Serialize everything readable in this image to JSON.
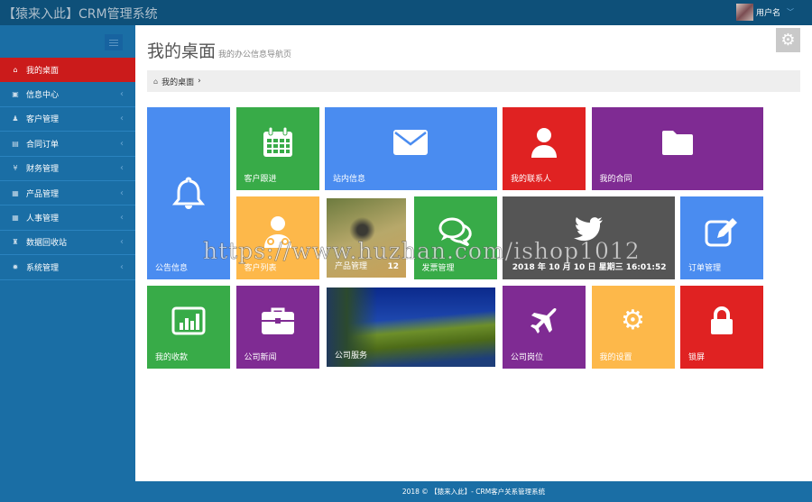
{
  "header": {
    "brand": "【猿来入此】CRM管理系统",
    "user_name": "用户名",
    "caret": "﹀"
  },
  "page": {
    "title": "我的桌面",
    "subtitle": "我的办公信息导航页"
  },
  "breadcrumb": {
    "items": [
      "我的桌面"
    ],
    "sep": "›"
  },
  "sidebar": {
    "items": [
      {
        "label": "我的桌面",
        "icon": "⌂",
        "active": true
      },
      {
        "label": "信息中心",
        "icon": "▣"
      },
      {
        "label": "客户管理",
        "icon": "♟"
      },
      {
        "label": "合同订单",
        "icon": "▤"
      },
      {
        "label": "财务管理",
        "icon": "¥"
      },
      {
        "label": "产品管理",
        "icon": "▦"
      },
      {
        "label": "人事管理",
        "icon": "▦"
      },
      {
        "label": "数据回收站",
        "icon": "♜"
      },
      {
        "label": "系统管理",
        "icon": "✹"
      }
    ],
    "chev": "‹"
  },
  "tiles": {
    "notice": "公告信息",
    "follow": "客户跟进",
    "messages": "站内信息",
    "contacts": "我的联系人",
    "contracts": "我的合同",
    "customers": "客户列表",
    "products": "产品管理",
    "products_count": "12",
    "invoices": "发票管理",
    "datetime": "2018 年 10 月 10 日 星期三 16:01:52",
    "orders": "订单管理",
    "receipts": "我的收款",
    "news": "公司新闻",
    "services": "公司服务",
    "positions": "公司岗位",
    "settings": "我的设置",
    "lock": "锁屏"
  },
  "footer": {
    "text": "2018 © 【猿来入此】- CRM客户关系管理系统"
  },
  "watermark": "https://www.huzhan.com/ishop1012"
}
